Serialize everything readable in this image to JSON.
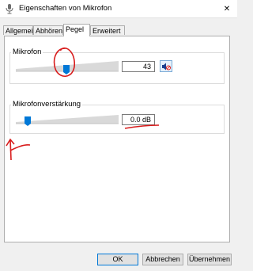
{
  "window": {
    "title": "Eigenschaften von Mikrofon",
    "close_glyph": "✕"
  },
  "tabs": [
    {
      "label": "Allgemein",
      "active": false
    },
    {
      "label": "Abhören",
      "active": false
    },
    {
      "label": "Pegel",
      "active": true
    },
    {
      "label": "Erweitert",
      "active": false
    }
  ],
  "mikrofon": {
    "label": "Mikrofon",
    "value": "43",
    "level_percent": 43,
    "mute_icon": "speaker-muted-icon"
  },
  "verstaerkung": {
    "label": "Mikrofonverstärkung",
    "value": "0.0 dB",
    "level_percent": 0
  },
  "buttons": {
    "ok": "OK",
    "cancel": "Abbrechen",
    "apply": "Übernehmen"
  },
  "colors": {
    "thumb": "#0078d7",
    "annotation": "#d81b1b"
  }
}
